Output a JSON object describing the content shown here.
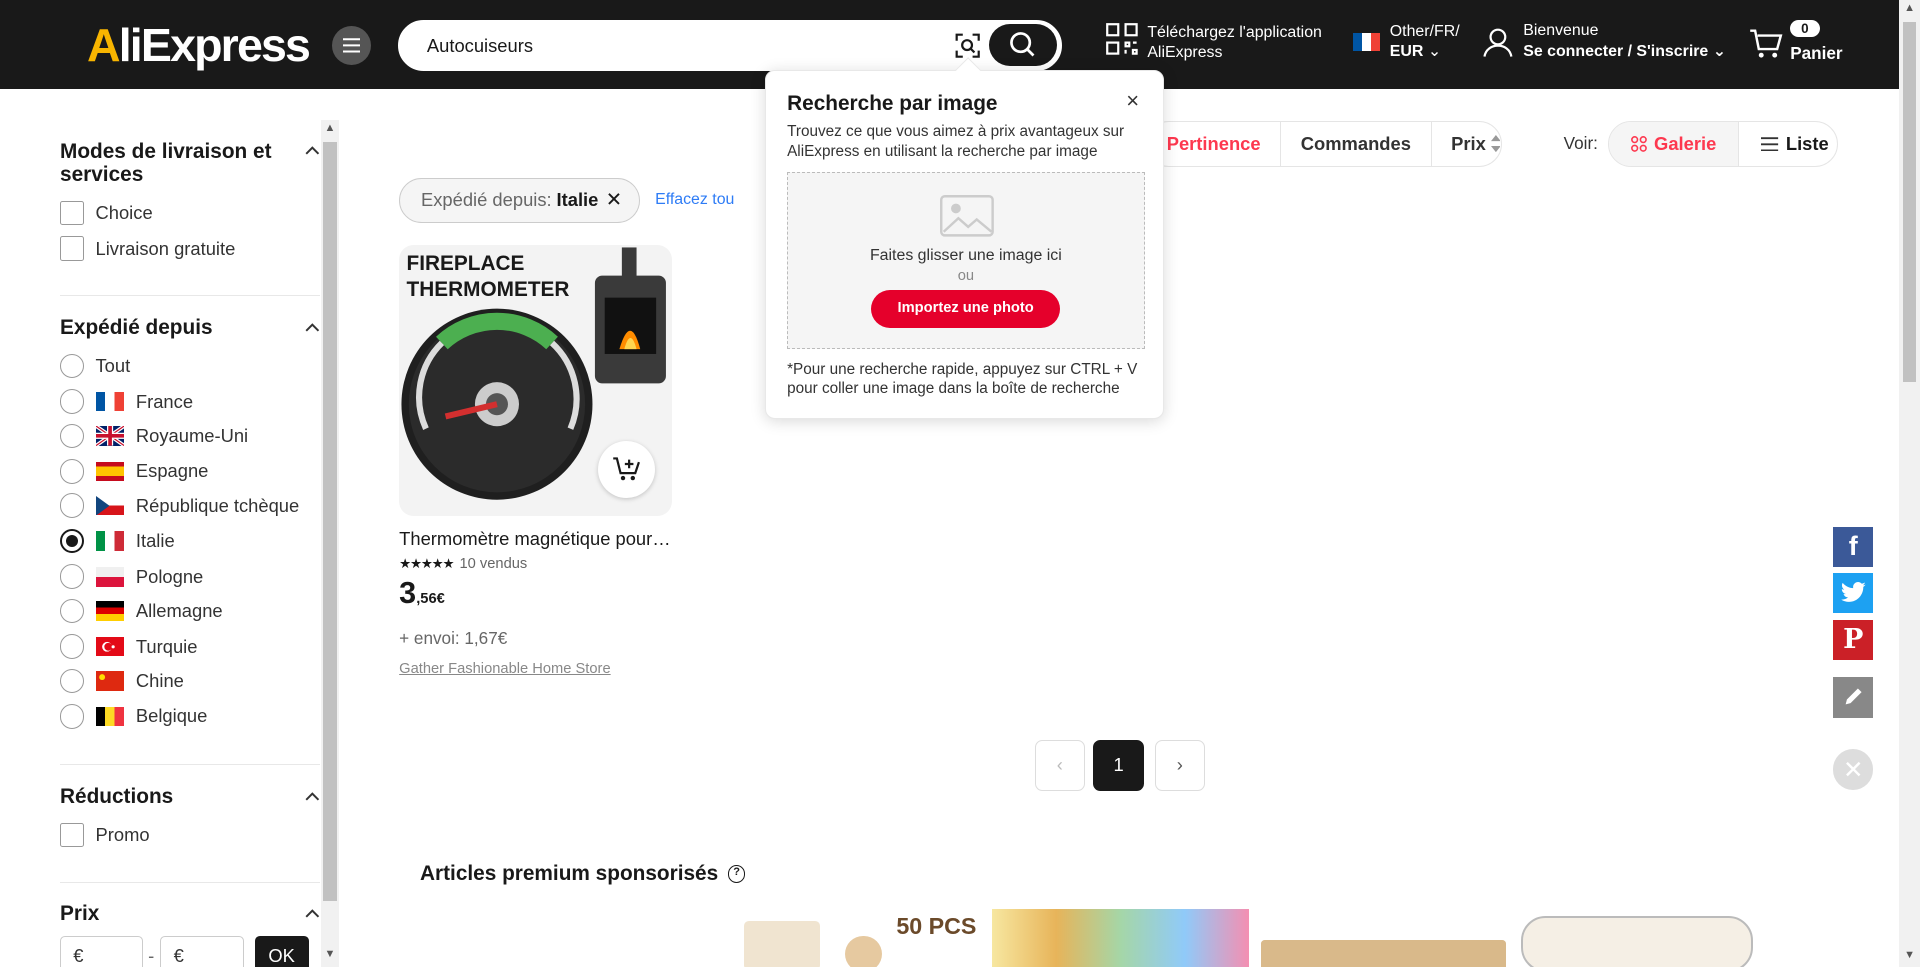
{
  "header": {
    "logo": "AliExpress",
    "search_value": "Autocuiseurs",
    "app_line1": "Téléchargez l'application",
    "app_line2": "AliExpress",
    "lang_line1": "Other/FR/",
    "lang_line2": "EUR",
    "user_line1": "Bienvenue",
    "user_line2": "Se connecter / S'inscrire",
    "cart_count": "0",
    "cart_label": "Panier"
  },
  "sidebar": {
    "delivery": {
      "title": "Modes de livraison et services",
      "options": [
        "Choice",
        "Livraison gratuite"
      ]
    },
    "shipped_from": {
      "title": "Expédié depuis",
      "options": [
        "Tout",
        "France",
        "Royaume-Uni",
        "Espagne",
        "République tchèque",
        "Italie",
        "Pologne",
        "Allemagne",
        "Turquie",
        "Chine",
        "Belgique"
      ],
      "selected": "Italie"
    },
    "discounts": {
      "title": "Réductions",
      "options": [
        "Promo"
      ]
    },
    "price": {
      "title": "Prix",
      "min_placeholder": "€",
      "max_placeholder": "€",
      "separator": "-",
      "ok": "OK"
    }
  },
  "sort": {
    "options": [
      "Pertinence",
      "Commandes",
      "Prix"
    ],
    "active": "Pertinence"
  },
  "view": {
    "label": "Voir:",
    "options": [
      "Galerie",
      "Liste"
    ],
    "active": "Galerie"
  },
  "filter_chip": {
    "label": "Expédié depuis:",
    "value": "Italie",
    "clear": "Effacez tou"
  },
  "product": {
    "img_title_line1": "FIREPLACE",
    "img_title_line2": "THERMOMETER",
    "title": "Thermomètre magnétique pour poêle à bois",
    "stars": "★★★★★",
    "sold": "10 vendus",
    "price_int": "3",
    "price_dec": ",56€",
    "shipping": "+ envoi: 1,67€",
    "store": "Gather Fashionable Home Store"
  },
  "pagination": {
    "prev": "‹",
    "current": "1",
    "next": "›"
  },
  "sponsored": {
    "title": "Articles premium sponsorisés",
    "thumb_text": "50 PCS"
  },
  "image_search_popup": {
    "title": "Recherche par image",
    "close": "×",
    "description": "Trouvez ce que vous aimez à prix avantageux sur AliExpress en utilisant la recherche par image",
    "drop_text": "Faites glisser une image ici",
    "or": "ou",
    "upload_button": "Importez une photo",
    "hint": "*Pour une recherche rapide, appuyez sur CTRL + V pour coller une image dans la boîte de recherche"
  },
  "colors": {
    "header_bg": "#191919",
    "accent_red": "#fd384f",
    "upload_red": "#e5002b",
    "link_blue": "#2e7cf6",
    "facebook": "#3b5998",
    "twitter": "#1da1f2",
    "pinterest": "#cb2027"
  }
}
